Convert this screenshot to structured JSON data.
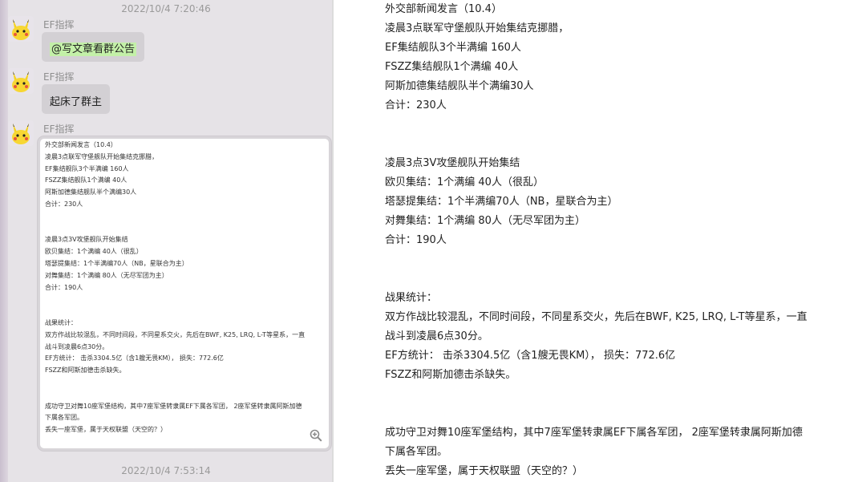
{
  "chat": {
    "timestamp_top": "2022/10/4 7:20:46",
    "timestamp_bottom": "2022/10/4 7:53:14",
    "messages": [
      {
        "sender": "EF指挥",
        "mention": "@写文章看群公告"
      },
      {
        "sender": "EF指挥",
        "text": "起床了群主"
      },
      {
        "sender": "EF指挥",
        "type": "image"
      }
    ]
  },
  "doc": {
    "lines": [
      "外交部新闻发言（10.4）",
      "凌晨3点联军守堡舰队开始集结克挪腊，",
      "EF集结舰队3个半满编 160人",
      "FSZZ集结舰队1个满编 40人",
      "阿斯加德集结舰队半个满编30人",
      "合计：230人",
      "",
      "",
      "凌晨3点3V攻堡舰队开始集结",
      "欧贝集结：1个满编 40人（很乱）",
      "塔瑟提集结：1个半满编70人（NB，星联合为主）",
      "对舞集结：1个满编 80人（无尽军团为主）",
      "合计：190人",
      "",
      "",
      "战果统计：",
      "双方作战比较混乱，不同时间段，不同星系交火，先后在BWF, K25, LRQ, L-T等星系，一直",
      "战斗到凌晨6点30分。",
      "EF方统计： 击杀3304.5亿（含1艘无畏KM）， 损失：772.6亿",
      "FSZZ和阿斯加德击杀缺失。",
      "",
      "",
      "成功守卫对舞10座军堡结构，其中7座军堡转隶属EF下属各军团， 2座军堡转隶属阿斯加德",
      "下属各军团。",
      "丢失一座军堡，属于天权联盟（天空的？）"
    ]
  },
  "icons": {
    "avatar": "pikachu-avatar-icon",
    "zoom": "zoom-in-icon"
  },
  "colors": {
    "chat_bg": "#e6e3e7",
    "bubble": "#d3d0d4",
    "mention_highlight": "#c3f0a8"
  }
}
